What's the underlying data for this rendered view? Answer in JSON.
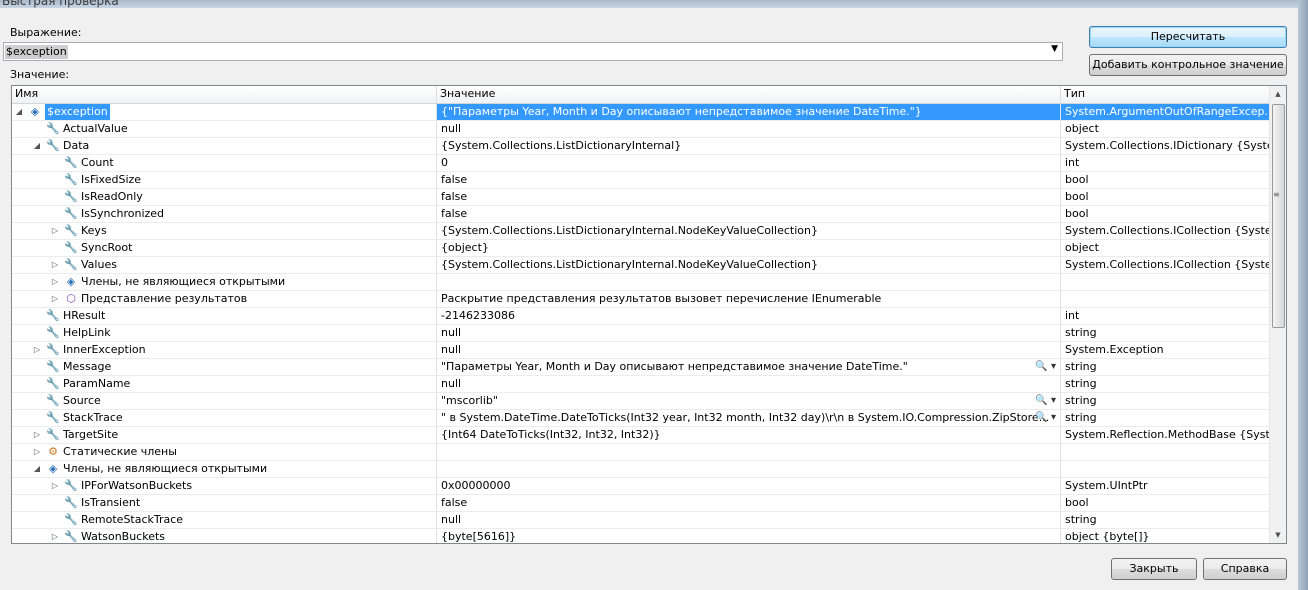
{
  "window": {
    "title": "Быстрая проверка"
  },
  "expression": {
    "label": "Выражение:",
    "value": "$exception"
  },
  "value_label": "Значение:",
  "buttons": {
    "recalculate": "Пересчитать",
    "add_watch": "Добавить контрольное значение",
    "close": "Закрыть",
    "help": "Справка"
  },
  "grid": {
    "columns": [
      "Имя",
      "Значение",
      "Тип"
    ],
    "rows": [
      {
        "level": 0,
        "expander": "open",
        "icon": "cube",
        "name": "$exception",
        "value": "{\"Параметры Year, Month и Day описывают непредставимое значение DateTime.\"}",
        "type": "System.ArgumentOutOfRangeExcep...",
        "selected": true
      },
      {
        "level": 1,
        "expander": "none",
        "icon": "wrench",
        "name": "ActualValue",
        "value": "null",
        "type": "object"
      },
      {
        "level": 1,
        "expander": "open",
        "icon": "wrench",
        "name": "Data",
        "value": "{System.Collections.ListDictionaryInternal}",
        "type": "System.Collections.IDictionary {Syste..."
      },
      {
        "level": 2,
        "expander": "none",
        "icon": "wrench",
        "name": "Count",
        "value": "0",
        "type": "int"
      },
      {
        "level": 2,
        "expander": "none",
        "icon": "wrench",
        "name": "IsFixedSize",
        "value": "false",
        "type": "bool"
      },
      {
        "level": 2,
        "expander": "none",
        "icon": "wrench",
        "name": "IsReadOnly",
        "value": "false",
        "type": "bool"
      },
      {
        "level": 2,
        "expander": "none",
        "icon": "wrench",
        "name": "IsSynchronized",
        "value": "false",
        "type": "bool"
      },
      {
        "level": 2,
        "expander": "closed",
        "icon": "wrench",
        "name": "Keys",
        "value": "{System.Collections.ListDictionaryInternal.NodeKeyValueCollection}",
        "type": "System.Collections.ICollection {Syste..."
      },
      {
        "level": 2,
        "expander": "none",
        "icon": "wrench",
        "name": "SyncRoot",
        "value": "{object}",
        "type": "object"
      },
      {
        "level": 2,
        "expander": "closed",
        "icon": "wrench",
        "name": "Values",
        "value": "{System.Collections.ListDictionaryInternal.NodeKeyValueCollection}",
        "type": "System.Collections.ICollection {Syste..."
      },
      {
        "level": 2,
        "expander": "closed",
        "icon": "cube",
        "name": "Члены, не являющиеся открытыми",
        "value": "",
        "type": ""
      },
      {
        "level": 2,
        "expander": "closed",
        "icon": "purple",
        "name": "Представление результатов",
        "value": "Раскрытие представления результатов вызовет перечисление IEnumerable",
        "type": ""
      },
      {
        "level": 1,
        "expander": "none",
        "icon": "wrench",
        "name": "HResult",
        "value": "-2146233086",
        "type": "int"
      },
      {
        "level": 1,
        "expander": "none",
        "icon": "wrench",
        "name": "HelpLink",
        "value": "null",
        "type": "string"
      },
      {
        "level": 1,
        "expander": "closed",
        "icon": "wrench",
        "name": "InnerException",
        "value": "null",
        "type": "System.Exception"
      },
      {
        "level": 1,
        "expander": "none",
        "icon": "wrench",
        "name": "Message",
        "value": "\"Параметры Year, Month и Day описывают непредставимое значение DateTime.\"",
        "type": "string",
        "visualizer": true
      },
      {
        "level": 1,
        "expander": "none",
        "icon": "wrench",
        "name": "ParamName",
        "value": "null",
        "type": "string"
      },
      {
        "level": 1,
        "expander": "none",
        "icon": "wrench",
        "name": "Source",
        "value": "\"mscorlib\"",
        "type": "string",
        "visualizer": true
      },
      {
        "level": 1,
        "expander": "none",
        "icon": "wrench",
        "name": "StackTrace",
        "value": "\"   в System.DateTime.DateToTicks(Int32 year, Int32 month, Int32 day)\\r\\n   в System.IO.Compression.ZipStore...",
        "type": "string",
        "visualizer": true
      },
      {
        "level": 1,
        "expander": "closed",
        "icon": "wrench",
        "name": "TargetSite",
        "value": "{Int64 DateToTicks(Int32, Int32, Int32)}",
        "type": "System.Reflection.MethodBase {Syst..."
      },
      {
        "level": 1,
        "expander": "closed",
        "icon": "stat",
        "name": "Статические члены",
        "value": "",
        "type": ""
      },
      {
        "level": 1,
        "expander": "open",
        "icon": "cube",
        "name": "Члены, не являющиеся открытыми",
        "value": "",
        "type": ""
      },
      {
        "level": 2,
        "expander": "closed",
        "icon": "lock",
        "name": "IPForWatsonBuckets",
        "value": "0x00000000",
        "type": "System.UIntPtr"
      },
      {
        "level": 2,
        "expander": "none",
        "icon": "lock",
        "name": "IsTransient",
        "value": "false",
        "type": "bool"
      },
      {
        "level": 2,
        "expander": "none",
        "icon": "lock",
        "name": "RemoteStackTrace",
        "value": "null",
        "type": "string"
      },
      {
        "level": 2,
        "expander": "closed",
        "icon": "lock",
        "name": "WatsonBuckets",
        "value": "{byte[5616]}",
        "type": "object {byte[]}"
      }
    ]
  },
  "icons": {
    "wrench": "wrench-icon",
    "cube": "cube-icon",
    "purple": "results-view-icon",
    "stat": "static-members-icon",
    "lock": "private-member-icon"
  }
}
